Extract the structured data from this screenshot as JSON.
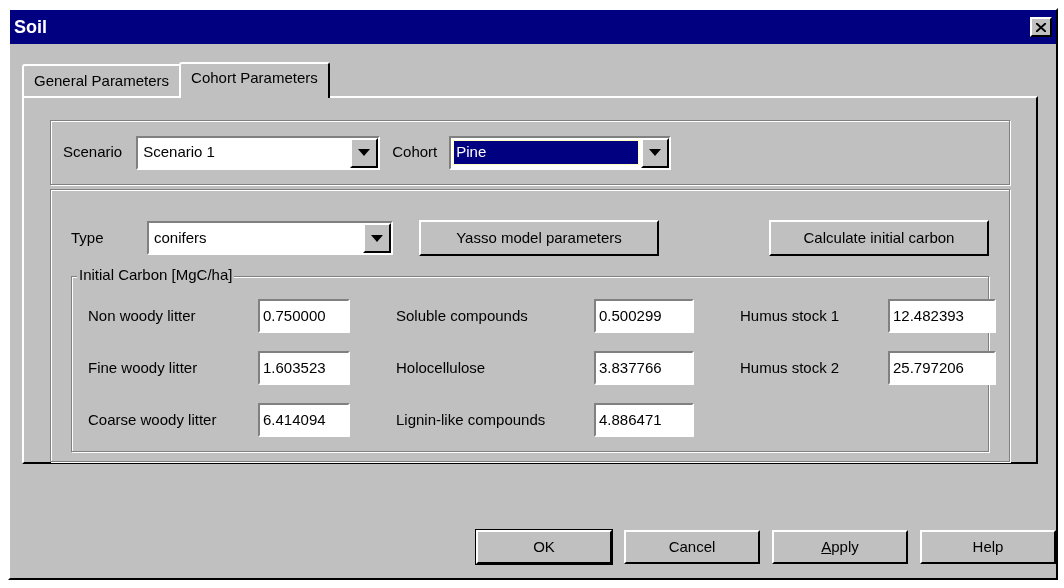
{
  "window": {
    "title": "Soil"
  },
  "tabs": [
    {
      "label": "General Parameters",
      "selected": false
    },
    {
      "label": "Cohort Parameters",
      "selected": true
    }
  ],
  "selectors": [
    {
      "label": "Scenario",
      "value": "Scenario 1",
      "highlighted": false
    },
    {
      "label": "Cohort",
      "value": "Pine",
      "highlighted": true
    }
  ],
  "type": {
    "label": "Type",
    "value": "conifers"
  },
  "action_buttons": [
    "Yasso model parameters",
    "Calculate initial carbon"
  ],
  "initial_carbon": {
    "title": "Initial Carbon [MgC/ha]",
    "columns": [
      [
        {
          "label": "Non woody litter",
          "value": "0.750000"
        },
        {
          "label": "Fine woody litter",
          "value": "1.603523"
        },
        {
          "label": "Coarse woody litter",
          "value": "6.414094"
        }
      ],
      [
        {
          "label": "Soluble compounds",
          "value": "0.500299"
        },
        {
          "label": "Holocellulose",
          "value": "3.837766"
        },
        {
          "label": "Lignin-like compounds",
          "value": "4.886471"
        }
      ],
      [
        {
          "label": "Humus stock 1",
          "value": "12.482393"
        },
        {
          "label": "Humus stock 2",
          "value": "25.797206"
        }
      ]
    ]
  },
  "buttons": [
    {
      "label": "OK",
      "default": true,
      "mnemonic": false
    },
    {
      "label": "Cancel",
      "default": false,
      "mnemonic": false
    },
    {
      "label": "Apply",
      "default": false,
      "mnemonic": true
    },
    {
      "label": "Help",
      "default": false,
      "mnemonic": false
    }
  ]
}
